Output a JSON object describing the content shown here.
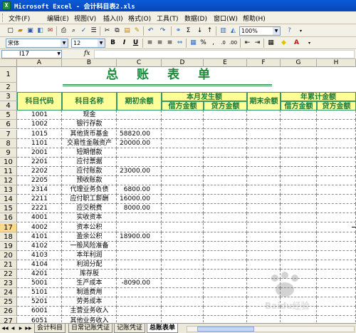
{
  "window": {
    "title": "Microsoft Excel - 会计科目表2.xls",
    "app_icon": "excel-icon"
  },
  "menu": [
    "文件(F)",
    "编辑(E)",
    "视图(V)",
    "插入(I)",
    "格式(O)",
    "工具(T)",
    "数据(D)",
    "窗口(W)",
    "帮助(H)"
  ],
  "toolbar": {
    "zoom": "100%",
    "font_name": "宋体",
    "font_size": "12",
    "bold": "B",
    "italic": "I",
    "underline": "U",
    "currency": "%"
  },
  "formula_bar": {
    "name_box": "I17",
    "fx": "fx",
    "content": ""
  },
  "sheet": {
    "title": "总账表单",
    "columns": [
      "A",
      "B",
      "C",
      "D",
      "E",
      "F",
      "G",
      "H"
    ],
    "rows": [
      "1",
      "2",
      "3",
      "4",
      "5",
      "6",
      "7",
      "8",
      "9",
      "10",
      "11",
      "12",
      "13",
      "14",
      "15",
      "16",
      "17",
      "18",
      "19",
      "20",
      "21",
      "22",
      "23",
      "24",
      "25",
      "26",
      "27"
    ],
    "active_row": "17",
    "headers": {
      "code": "科目代码",
      "name": "科目名称",
      "opening": "期初余额",
      "month_amount": "本月发生额",
      "closing": "期末余额",
      "ytd_amount": "年累计金额",
      "debit": "借方金额",
      "credit": "贷方金额",
      "debit2": "借方金额",
      "credit2": "贷方金额"
    },
    "data": [
      {
        "code": "1001",
        "name": "现金",
        "opening": ""
      },
      {
        "code": "1002",
        "name": "银行存款",
        "opening": ""
      },
      {
        "code": "1015",
        "name": "其他货币基金",
        "opening": "58820.00"
      },
      {
        "code": "1101",
        "name": "交易性金融资产",
        "opening": "20000.00"
      },
      {
        "code": "2001",
        "name": "短期借款",
        "opening": ""
      },
      {
        "code": "2201",
        "name": "应付票据",
        "opening": ""
      },
      {
        "code": "2202",
        "name": "应付账款",
        "opening": "23000.00"
      },
      {
        "code": "2205",
        "name": "预收账款",
        "opening": ""
      },
      {
        "code": "2314",
        "name": "代理业务负债",
        "opening": "6800.00"
      },
      {
        "code": "2211",
        "name": "应付职工薪酬",
        "opening": "16000.00"
      },
      {
        "code": "2221",
        "name": "应交税费",
        "opening": "8000.00"
      },
      {
        "code": "4001",
        "name": "实收资本",
        "opening": ""
      },
      {
        "code": "4002",
        "name": "资本公积",
        "opening": ""
      },
      {
        "code": "4101",
        "name": "盈余公积",
        "opening": "18900.00"
      },
      {
        "code": "4102",
        "name": "一般风险准备",
        "opening": ""
      },
      {
        "code": "4103",
        "name": "本年利润",
        "opening": ""
      },
      {
        "code": "4104",
        "name": "利润分配",
        "opening": ""
      },
      {
        "code": "4201",
        "name": "库存股",
        "opening": ""
      },
      {
        "code": "5001",
        "name": "生产成本",
        "opening": "-8090.00"
      },
      {
        "code": "5101",
        "name": "制造费用",
        "opening": ""
      },
      {
        "code": "5201",
        "name": "劳务成本",
        "opening": ""
      },
      {
        "code": "6001",
        "name": "主营业务收入",
        "opening": ""
      },
      {
        "code": "6051",
        "name": "其他业务收入",
        "opening": ""
      }
    ]
  },
  "tabs": [
    "会计科目",
    "日常记账凭证",
    "记账凭证",
    "总账表单"
  ],
  "active_tab": "总账表单",
  "watermark": "Baidu经验"
}
